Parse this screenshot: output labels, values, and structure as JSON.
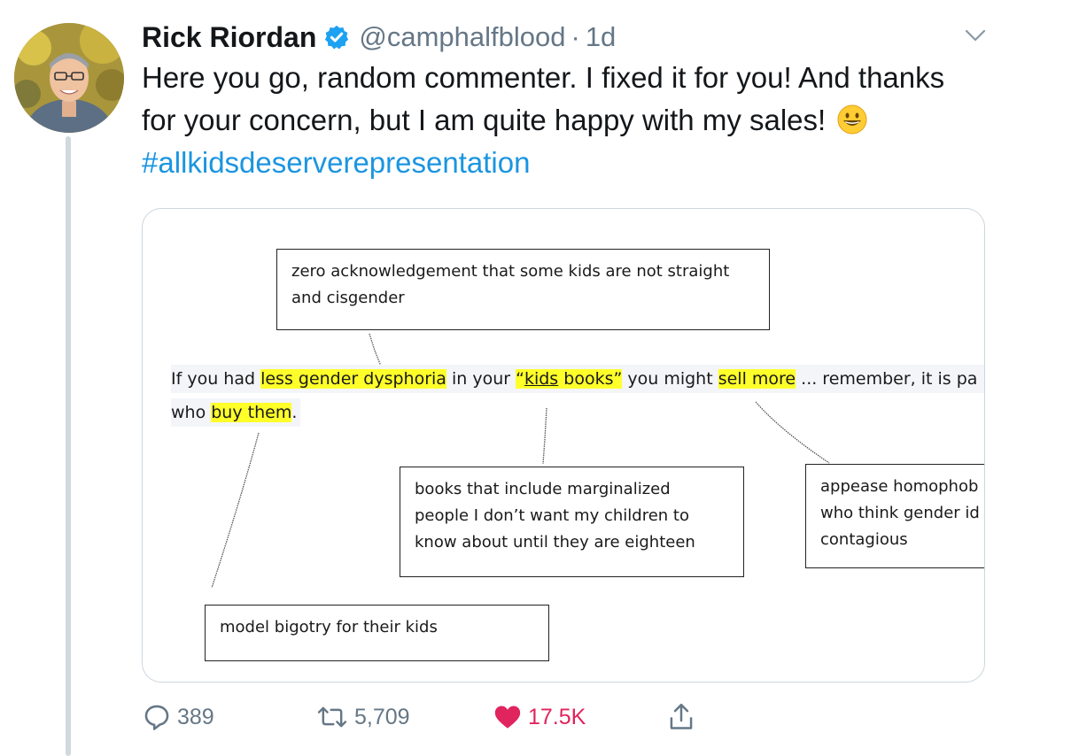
{
  "tweet": {
    "author_name": "Rick Riordan",
    "handle": "@camphalfblood",
    "separator": "·",
    "timestamp": "1d",
    "text_part1": "Here you go, random commenter. I fixed it for you! And thanks for your concern, but I am quite happy with my sales!",
    "hashtag": "#allkidsdeserverepresentation",
    "emoji": "grinning-face-emoji"
  },
  "image": {
    "top_note": "zero acknowledgement that some kids are not straight and cisgender",
    "quote": {
      "seg1": "If you had ",
      "hl1": "less gender dysphoria",
      "seg2": " in your ",
      "hl2_open": "“",
      "hl2_kids": "kids",
      "hl2_rest": " books”",
      "seg3": " you might ",
      "hl3": "sell more",
      "seg4": " ... remember, it is pa",
      "line2_seg1": "who ",
      "line2_hl": "buy them",
      "line2_end": "."
    },
    "note_books": "books that include marginalized people I don’t want my children to know about until they are eighteen",
    "note_appease": "appease homophob who think gender id contagious",
    "note_bigotry": "model bigotry for their kids"
  },
  "actions": {
    "reply_count": "389",
    "retweet_count": "5,709",
    "like_count": "17.5K"
  },
  "colors": {
    "hashtag": "#1b95e0",
    "like": "#e0245e",
    "verified": "#1da1f2",
    "highlight": "#ffff2a",
    "muted": "#657786"
  }
}
